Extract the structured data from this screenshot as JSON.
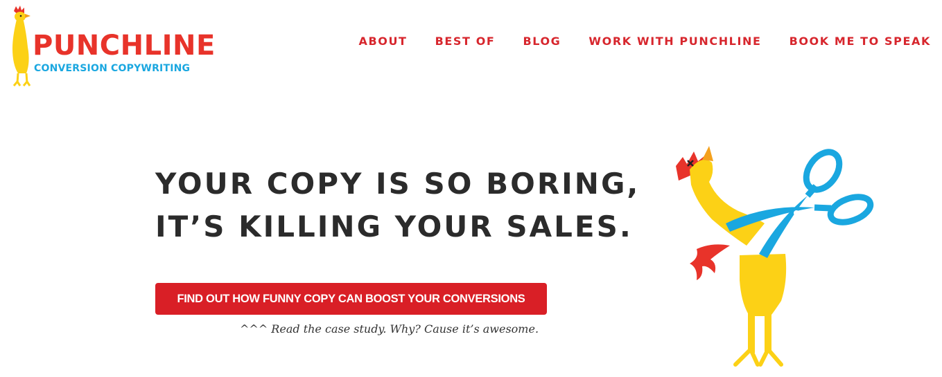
{
  "brand": {
    "name": "PUNCHLINE",
    "tagline": "CONVERSION COPYWRITING",
    "primary_color": "#e8332a",
    "secondary_color": "#1aa7e0"
  },
  "nav": {
    "items": [
      {
        "label": "ABOUT"
      },
      {
        "label": "BEST OF"
      },
      {
        "label": "BLOG"
      },
      {
        "label": "WORK WITH PUNCHLINE"
      },
      {
        "label": "BOOK ME TO SPEAK"
      }
    ],
    "color": "#d7262d"
  },
  "hero": {
    "headline_line1": "YOUR COPY IS SO BORING,",
    "headline_line2": "IT’S KILLING YOUR SALES.",
    "cta_label": "FIND OUT HOW FUNNY COPY CAN BOOST YOUR CONVERSIONS",
    "cta_color": "#d91f26",
    "caption": "^^^ Read the case study. Why? Cause it’s awesome.",
    "illustration": "rubber-chicken-cut-by-scissors-icon"
  }
}
